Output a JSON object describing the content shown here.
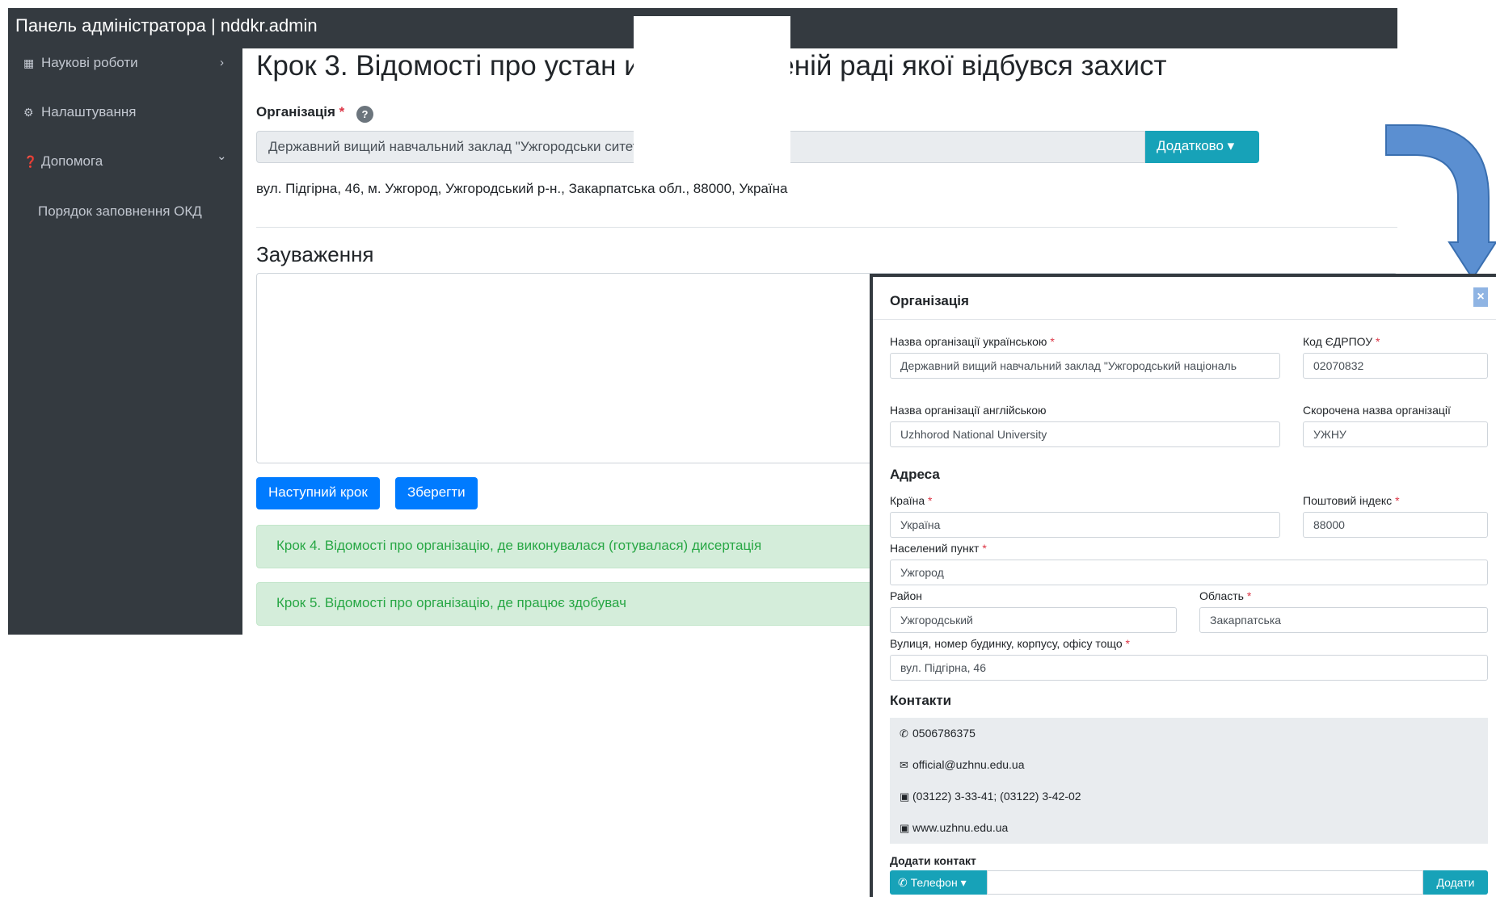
{
  "header": {
    "brand": "Панель адміністратора | nddkr.admin"
  },
  "sidebar": {
    "items": [
      {
        "label": "Наукові роботи",
        "icon": "table-icon",
        "chevron": "›"
      },
      {
        "label": "Налаштування",
        "icon": "gears-icon"
      },
      {
        "label": "Допомога",
        "icon": "question-circle-icon",
        "chevron": "⌄"
      },
      {
        "label": "Порядок заповнення ОКД"
      }
    ]
  },
  "main": {
    "step_title": "Крок 3. Відомості про устан изацію, у вченій раді якої відбувся захист",
    "org_label": "Організація",
    "required_mark": "*",
    "help_icon": "?",
    "org_value": "Державний вищий навчальний заклад \"Ужгородськи ситет\"",
    "extra_button": "Додатково ▾",
    "address": "вул. Підгірна, 46, м. Ужгород, Ужгородський р-н., Закарпатська обл., 88000, Україна",
    "remarks_title": "Зауваження",
    "next_button": "Наступний крок",
    "save_button": "Зберегти",
    "alerts": [
      "Крок 4. Відомості про організацію, де виконувалася (готувалася) дисертація",
      "Крок 5. Відомості про організацію, де працює здобувач"
    ]
  },
  "modal": {
    "title": "Організація",
    "close": "×",
    "fields": {
      "name_uk_label": "Назва організації українською",
      "name_uk_value": "Державний вищий навчальний заклад \"Ужгородський національ",
      "edrpou_label": "Код ЄДРПОУ",
      "edrpou_value": "02070832",
      "name_en_label": "Назва організації англійською",
      "name_en_value": "Uzhhorod National University",
      "short_label": "Скорочена назва організації",
      "short_value": "УЖНУ"
    },
    "address_section": "Адреса",
    "address": {
      "country_label": "Країна",
      "country_value": "Україна",
      "postal_label": "Поштовий індекс",
      "postal_value": "88000",
      "city_label": "Населений пункт",
      "city_value": "Ужгород",
      "district_label": "Район",
      "district_value": "Ужгородський",
      "region_label": "Область",
      "region_value": "Закарпатська",
      "street_label": "Вулиця, номер будинку, корпусу, офісу тощо",
      "street_value": "вул. Підгірна, 46"
    },
    "contacts_section": "Контакти",
    "contacts": [
      {
        "icon": "phone-icon",
        "value": "0506786375"
      },
      {
        "icon": "envelope-icon",
        "value": "official@uzhnu.edu.ua"
      },
      {
        "icon": "contact-card-icon",
        "value": "(03122) 3-33-41; (03122) 3-42-02"
      },
      {
        "icon": "contact-card-icon",
        "value": "www.uzhnu.edu.ua"
      }
    ],
    "add_contact_label": "Додати контакт",
    "contact_type_button": "Телефон ▾",
    "add_button": "Додати"
  },
  "colors": {
    "dark": "#343a40",
    "primary": "#007bff",
    "info": "#17a2b8",
    "success_bg": "#d4edda",
    "success_text": "#28a745",
    "arrow": "#5b8fd1"
  }
}
